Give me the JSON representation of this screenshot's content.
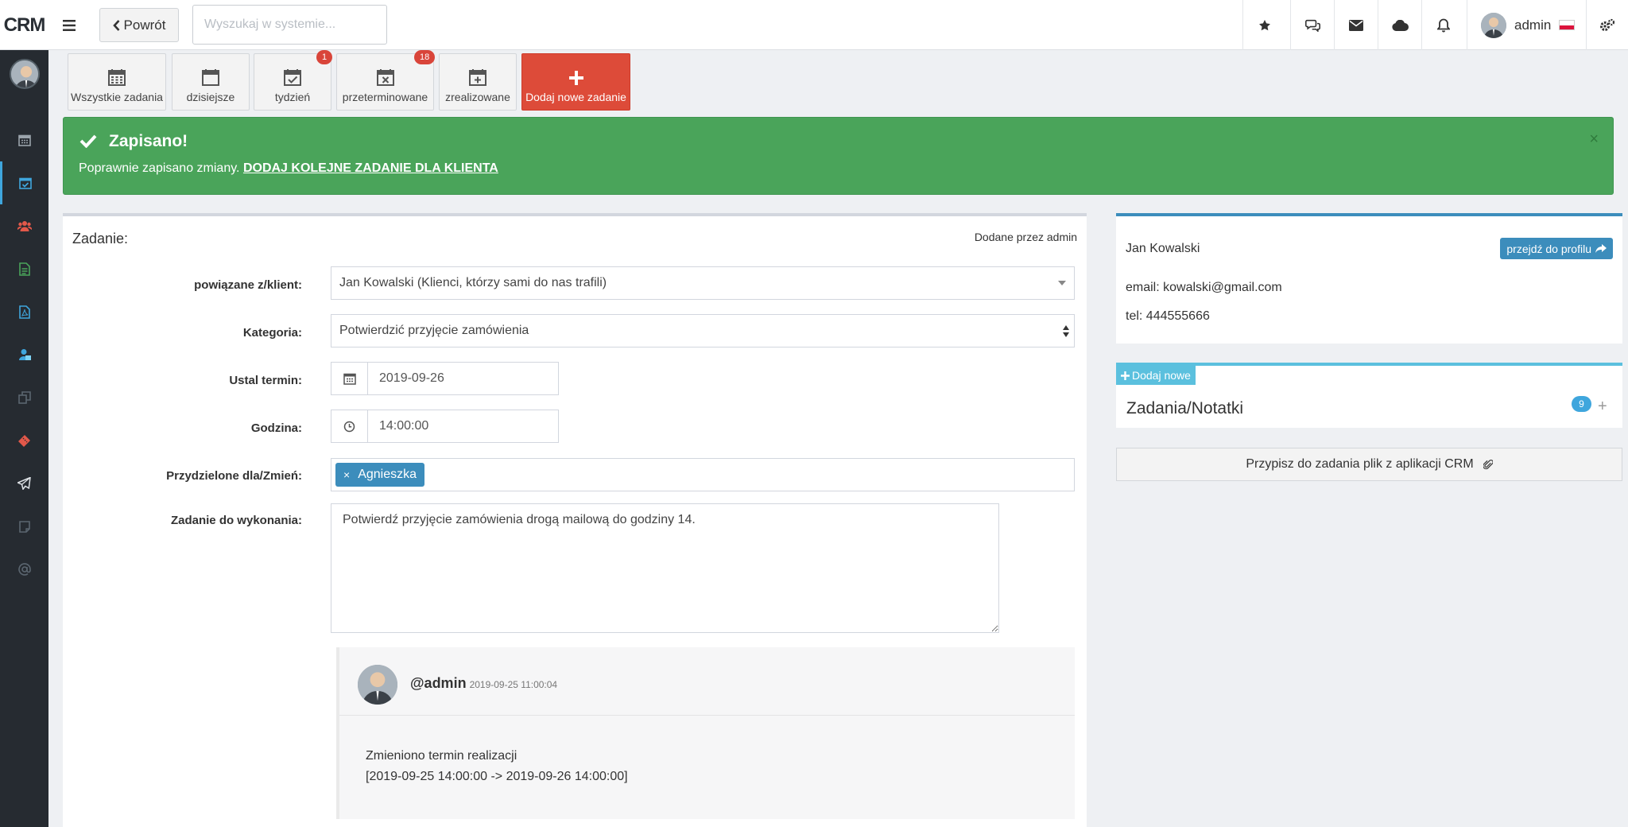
{
  "app": {
    "logo": "CRM"
  },
  "topbar": {
    "back_label": "Powrót",
    "search_placeholder": "Wyszukaj w systemie...",
    "icons": [
      "star-icon",
      "chat-icon",
      "envelope-icon",
      "cloud-icon",
      "bell-icon",
      "cogs-icon"
    ],
    "user_name": "admin"
  },
  "sidebar": {
    "items": [
      "calendar-icon",
      "calendar-check-icon",
      "users-icon",
      "document-icon",
      "pdf-icon",
      "support-icon",
      "copy-icon",
      "ticket-icon",
      "send-icon",
      "note-icon",
      "at-icon"
    ],
    "active_index": 1
  },
  "tabs": [
    {
      "label": "Wszystkie zadania",
      "icon": "calendar-icon",
      "badge": ""
    },
    {
      "label": "dzisiejsze",
      "icon": "calendar-blank-icon",
      "badge": ""
    },
    {
      "label": "tydzień",
      "icon": "calendar-check-icon",
      "badge": "1"
    },
    {
      "label": "przeterminowane",
      "icon": "calendar-times-icon",
      "badge": "18"
    },
    {
      "label": "zrealizowane",
      "icon": "calendar-plus-icon",
      "badge": ""
    },
    {
      "label": "Dodaj nowe zadanie",
      "icon": "plus-icon",
      "badge": ""
    }
  ],
  "alert": {
    "title": "Zapisano!",
    "text": "Poprawnie zapisano zmiany.",
    "link": "DODAJ KOLEJNE ZADANIE DLA KLIENTA",
    "close": "×"
  },
  "task": {
    "title": "Zadanie:",
    "added_by": "Dodane przez admin",
    "fields": {
      "client_label": "powiązane z/klient:",
      "client_value": "Jan Kowalski (Klienci, którzy sami do nas trafili)",
      "category_label": "Kategoria:",
      "category_value": "Potwierdzić przyjęcie zamówienia",
      "date_label": "Ustal termin:",
      "date_value": "2019-09-26",
      "time_label": "Godzina:",
      "time_value": "14:00:00",
      "assigned_label": "Przydzielone dla/Zmień:",
      "assigned_remove": "×",
      "assigned_value": "Agnieszka",
      "todo_label": "Zadanie do wykonania:",
      "todo_value": "Potwierdź przyjęcie zamówienia drogą mailową do godziny 14."
    }
  },
  "comment": {
    "author": "@admin",
    "date": "2019-09-25 11:00:04",
    "line1": "Zmieniono termin realizacji",
    "line2": "[2019-09-25 14:00:00 -> 2019-09-26 14:00:00]"
  },
  "client": {
    "name": "Jan Kowalski",
    "profile_button": "przejdź do profilu",
    "email": "email: kowalski@gmail.com",
    "phone": "tel: 444555666"
  },
  "notes": {
    "add_new": "Dodaj nowe",
    "title": "Zadania/Notatki",
    "count": "9",
    "add_symbol": "+"
  },
  "attach": {
    "label": "Przypisz do zadania plik z aplikacji CRM"
  },
  "colors": {
    "sidebar": "#262b31",
    "success": "#4aa45a",
    "primary": "#3c8dbc",
    "danger": "#dd4b39",
    "info": "#5bc0de"
  }
}
